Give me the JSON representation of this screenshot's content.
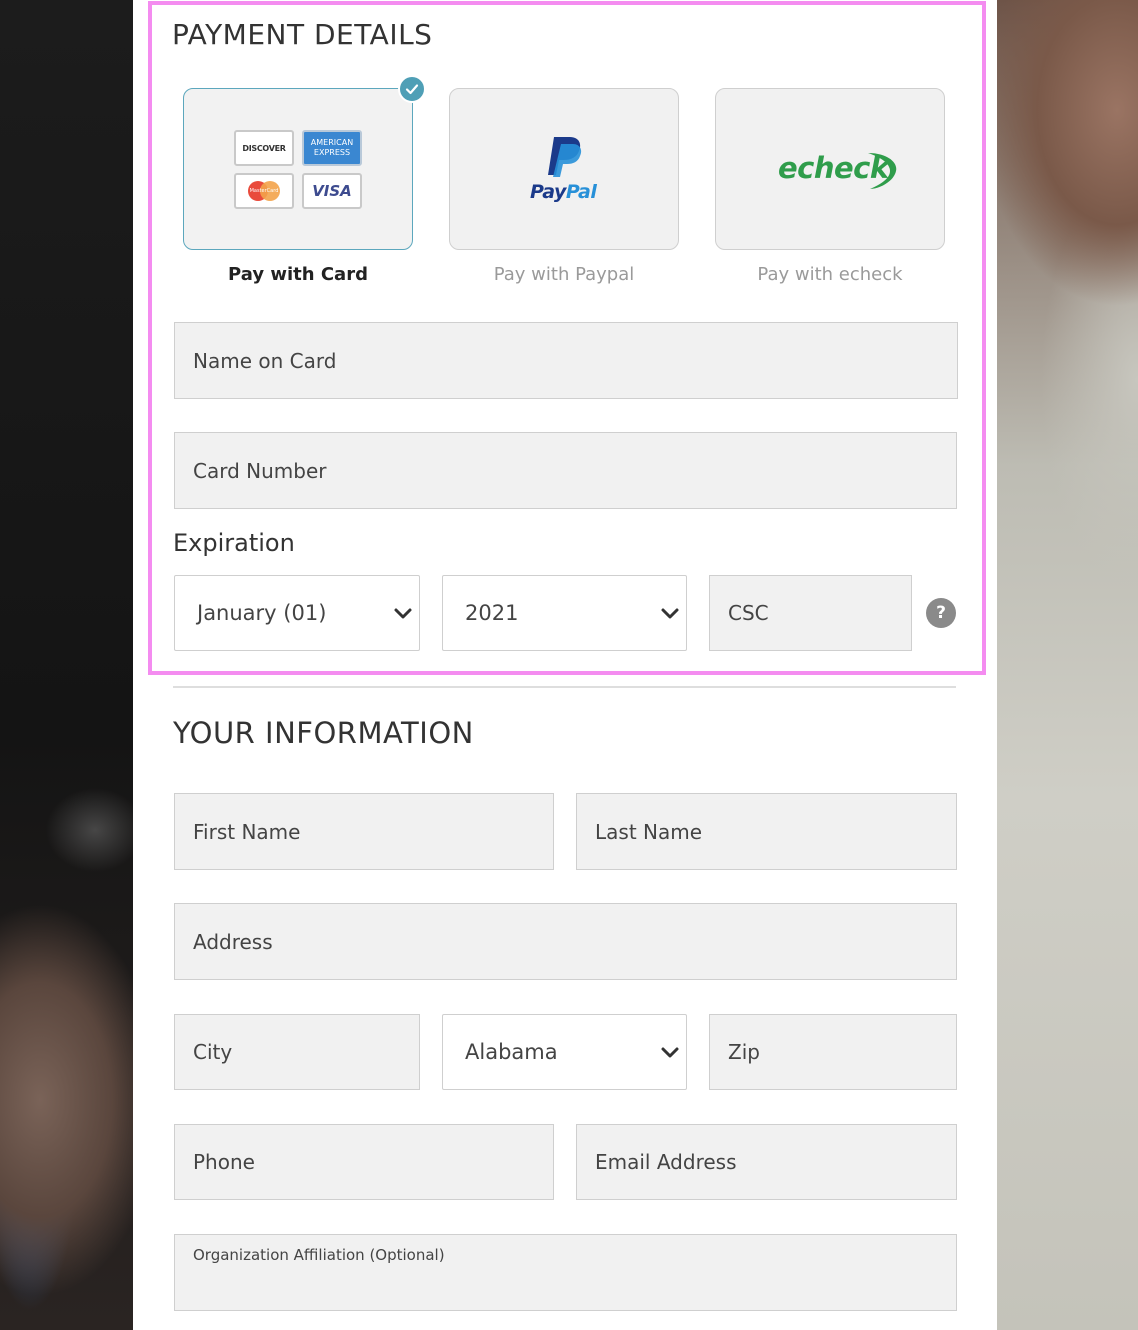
{
  "payment": {
    "title": "PAYMENT DETAILS",
    "methods": [
      {
        "label": "Pay with Card",
        "selected": true
      },
      {
        "label": "Pay with Paypal",
        "selected": false
      },
      {
        "label": "Pay with echeck",
        "selected": false
      }
    ],
    "logos": {
      "discover": "DISCOVER",
      "amex_top": "AMERICAN",
      "amex_bottom": "EXPRESS",
      "visa": "VISA",
      "mastercard": "MasterCard",
      "paypal": "PayPal",
      "paypal_p": "P",
      "echeck": "echeck"
    },
    "name_on_card_placeholder": "Name on Card",
    "card_number_placeholder": "Card Number",
    "expiration_label": "Expiration",
    "month_value": "January (01)",
    "year_value": "2021",
    "csc_placeholder": "CSC",
    "help_glyph": "?"
  },
  "info": {
    "title": "YOUR INFORMATION",
    "first_name_placeholder": "First Name",
    "last_name_placeholder": "Last Name",
    "address_placeholder": "Address",
    "city_placeholder": "City",
    "state_value": "Alabama",
    "zip_placeholder": "Zip",
    "phone_placeholder": "Phone",
    "email_placeholder": "Email Address",
    "organization_placeholder": "Organization Affiliation (Optional)"
  },
  "colors": {
    "highlight": "#f48cf0",
    "accent": "#4f9fb6",
    "paypal_dark": "#1b3a8a",
    "paypal_light": "#2790d8",
    "echeck_green": "#2f9d4b"
  },
  "icons": [
    "check-icon",
    "chevron-down-icon",
    "help-icon"
  ]
}
